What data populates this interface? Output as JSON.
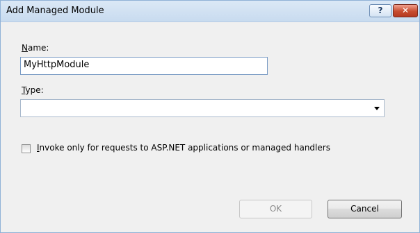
{
  "window": {
    "title": "Add Managed Module",
    "help_glyph": "?",
    "close_glyph": "✕"
  },
  "form": {
    "name_label_mnemonic": "N",
    "name_label_rest": "ame:",
    "name_value": "MyHttpModule",
    "type_label_mnemonic": "T",
    "type_label_rest": "ype:",
    "type_value": "",
    "checkbox_mnemonic": "I",
    "checkbox_rest": "nvoke only for requests to ASP.NET applications or managed handlers",
    "checkbox_checked": false
  },
  "buttons": {
    "ok_label": "OK",
    "ok_enabled": false,
    "cancel_label": "Cancel"
  },
  "icons": {
    "help": "help-icon",
    "close": "close-icon",
    "dropdown": "chevron-down-icon"
  }
}
